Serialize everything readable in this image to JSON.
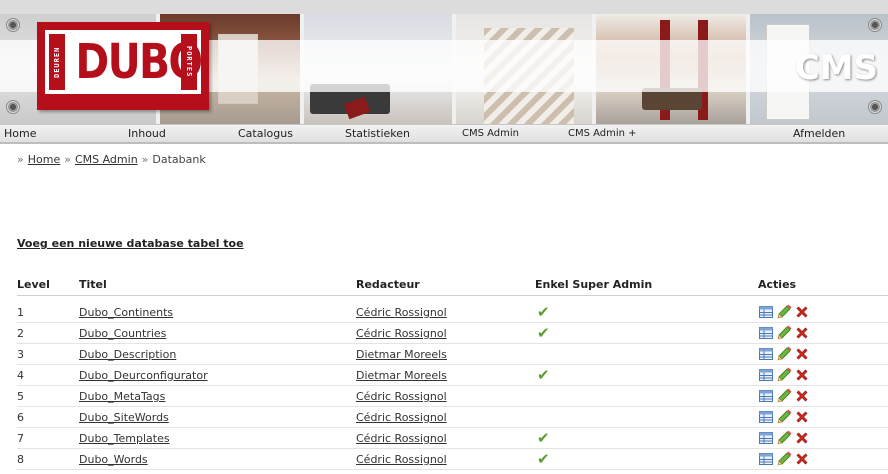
{
  "banner": {
    "logo_text": "DUBO",
    "logo_left_text": "DEUREN",
    "logo_right_text": "PORTES",
    "cms_title": "CMS",
    "brand_red": "#b50f1c"
  },
  "nav": {
    "items": [
      {
        "label": "Home"
      },
      {
        "label": "Inhoud"
      },
      {
        "label": "Catalogus"
      },
      {
        "label": "Statistieken"
      },
      {
        "label": "CMS Admin"
      },
      {
        "label": "CMS Admin +"
      },
      {
        "label": "Afmelden"
      }
    ]
  },
  "breadcrumb": {
    "separator": "»",
    "items": [
      {
        "label": "Home"
      },
      {
        "label": "CMS Admin"
      },
      {
        "label": "Databank"
      }
    ]
  },
  "add_link": "Voeg een nieuwe database tabel toe",
  "table": {
    "headers": {
      "level": "Level",
      "title": "Titel",
      "editor": "Redacteur",
      "super_admin": "Enkel Super Admin",
      "actions": "Acties"
    },
    "check_color": "#5aa02c",
    "rows": [
      {
        "level": "1",
        "title": "Dubo_Continents",
        "editor": "Cédric Rossignol",
        "super_admin_only": true
      },
      {
        "level": "2",
        "title": "Dubo_Countries",
        "editor": "Cédric Rossignol",
        "super_admin_only": true
      },
      {
        "level": "3",
        "title": "Dubo_Description",
        "editor": "Dietmar Moreels",
        "super_admin_only": false
      },
      {
        "level": "4",
        "title": "Dubo_Deurconfigurator",
        "editor": "Dietmar Moreels",
        "super_admin_only": true
      },
      {
        "level": "5",
        "title": "Dubo_MetaTags",
        "editor": "Cédric Rossignol",
        "super_admin_only": false
      },
      {
        "level": "6",
        "title": "Dubo_SiteWords",
        "editor": "Cédric Rossignol",
        "super_admin_only": false
      },
      {
        "level": "7",
        "title": "Dubo_Templates",
        "editor": "Cédric Rossignol",
        "super_admin_only": true
      },
      {
        "level": "8",
        "title": "Dubo_Words",
        "editor": "Cédric Rossignol",
        "super_admin_only": true
      }
    ],
    "action_icons": [
      "table-view-icon",
      "pencil-edit-icon",
      "red-x-delete-icon"
    ]
  }
}
